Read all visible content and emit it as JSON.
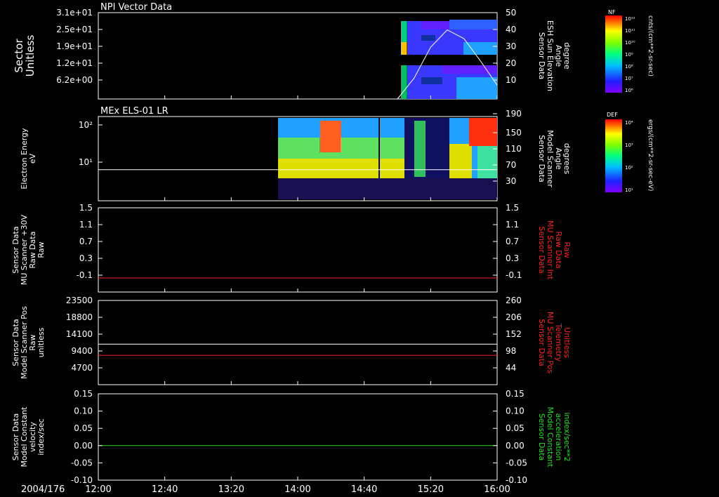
{
  "date_label": "2004/176",
  "time_ticks": [
    "12:00",
    "12:40",
    "13:20",
    "14:00",
    "14:40",
    "15:20",
    "16:00"
  ],
  "panels": [
    {
      "title": "NPI Vector Data",
      "left_label": [
        "Sector",
        "Unitless"
      ],
      "left_ticks": [
        "3.1e+01",
        "2.5e+01",
        "1.9e+01",
        "1.2e+01",
        "6.2e+00"
      ],
      "right_label": [
        "Sensor Data",
        "ESH Sun Elevation",
        "Angle",
        "degree"
      ],
      "right_ticks": [
        "50",
        "40",
        "30",
        "20",
        "10"
      ],
      "colorbar_tag": "NF",
      "colorbar_ticks": [
        "10¹²",
        "10¹¹",
        "10¹⁰",
        "10⁹",
        "10⁸",
        "10⁷",
        "10⁶"
      ],
      "colorbar_units": "cnts/(cm**2-sr-sec)"
    },
    {
      "title": "MEx ELS-01 LR",
      "left_label": [
        "Electron Energy",
        "eV"
      ],
      "left_ticks": [
        "10²",
        "10¹"
      ],
      "right_label": [
        "Sensor Data",
        "Model Scanner",
        "Angle",
        "degrees"
      ],
      "right_ticks": [
        "190",
        "150",
        "110",
        "70",
        "30"
      ],
      "colorbar_tag": "DEF",
      "colorbar_ticks": [
        "10⁴",
        "10³",
        "10²",
        "10¹"
      ],
      "colorbar_units": "ergs/(cm**2-sr-sec-eV)"
    },
    {
      "title": "",
      "left_label": [
        "Sensor Data",
        "MU Scanner +30V",
        "Raw Data",
        "Raw"
      ],
      "left_ticks": [
        "1.5",
        "1.1",
        "0.7",
        "0.3",
        "-0.1"
      ],
      "right_label": [
        "Sensor Data",
        "MU Scanner Int",
        "Raw Data",
        "Raw"
      ],
      "right_ticks": [
        "1.5",
        "1.1",
        "0.7",
        "0.3",
        "-0.1"
      ]
    },
    {
      "title": "",
      "left_label": [
        "Sensor Data",
        "Model Scanner Pos",
        "Raw",
        "unitless"
      ],
      "left_ticks": [
        "23500",
        "18800",
        "14100",
        "9400",
        "4700"
      ],
      "right_label": [
        "Sensor Data",
        "MU Scanner Pos",
        "Telemetry",
        "Unitless"
      ],
      "right_ticks": [
        "260",
        "206",
        "152",
        "98",
        "44"
      ]
    },
    {
      "title": "",
      "left_label": [
        "Sensor Data",
        "Model Constant",
        "velocity",
        "index/sec"
      ],
      "left_ticks": [
        "0.15",
        "0.10",
        "0.05",
        "0.00",
        "-0.05",
        "-0.10"
      ],
      "right_label": [
        "Sensor Data",
        "Model Constant",
        "acceleration",
        "index/sec**2"
      ],
      "right_ticks": [
        "0.15",
        "0.10",
        "0.05",
        "0.00",
        "-0.05",
        "-0.10"
      ]
    }
  ],
  "colors": {
    "red": "#ff2020",
    "green": "#20e020",
    "white": "#ffffff"
  },
  "chart_data": [
    {
      "type": "heatmap",
      "panel": 0,
      "title": "NPI Vector Data",
      "xrange": [
        "12:00",
        "16:00"
      ],
      "ylim_left": [
        0,
        31
      ],
      "ylim_right": [
        0,
        50
      ],
      "data_start": "15:00",
      "line_series": {
        "name": "ESH Sun Elevation Angle",
        "x_minutes": [
          180,
          190,
          200,
          210,
          220,
          230,
          240
        ],
        "y": [
          0,
          12,
          30,
          40,
          35,
          22,
          8
        ]
      }
    },
    {
      "type": "heatmap",
      "panel": 1,
      "title": "MEx ELS-01 LR",
      "xrange": [
        "12:00",
        "16:00"
      ],
      "yscale": "log",
      "ylim_left": [
        1,
        190
      ],
      "ylim_right": [
        0,
        190
      ],
      "data_start": "13:40",
      "line_series": {
        "name": "Model Scanner Angle",
        "y": [
          70
        ]
      }
    },
    {
      "type": "line",
      "panel": 2,
      "ylim": [
        -0.3,
        1.5
      ],
      "series": [
        {
          "name": "MU Scanner Int",
          "color": "red",
          "y": [
            0.0
          ]
        }
      ]
    },
    {
      "type": "line",
      "panel": 3,
      "ylim_left": [
        0,
        23500
      ],
      "ylim_right": [
        0,
        260
      ],
      "series": [
        {
          "name": "Model Scanner Pos",
          "color": "white",
          "y": [
            11300
          ]
        },
        {
          "name": "MU Scanner Pos",
          "color": "red",
          "y": [
            8200
          ]
        }
      ]
    },
    {
      "type": "line",
      "panel": 4,
      "ylim": [
        -0.1,
        0.15
      ],
      "series": [
        {
          "name": "Model Constant velocity",
          "color": "green",
          "y": [
            0.0
          ]
        }
      ]
    }
  ]
}
